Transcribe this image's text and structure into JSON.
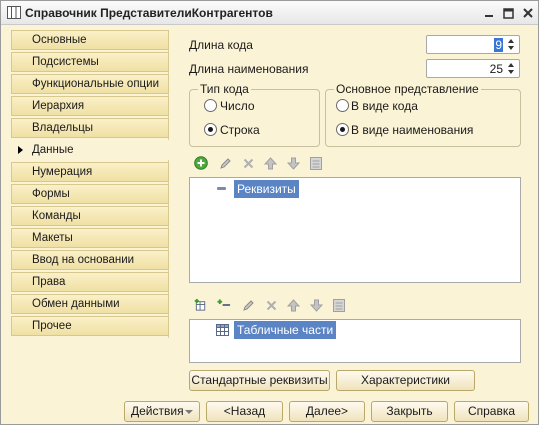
{
  "window": {
    "title": "Справочник ПредставителиКонтрагентов"
  },
  "sidebar": {
    "items": [
      {
        "label": "Основные"
      },
      {
        "label": "Подсистемы"
      },
      {
        "label": "Функциональные опции"
      },
      {
        "label": "Иерархия"
      },
      {
        "label": "Владельцы"
      },
      {
        "label": "Данные",
        "active": true
      },
      {
        "label": "Нумерация"
      },
      {
        "label": "Формы"
      },
      {
        "label": "Команды"
      },
      {
        "label": "Макеты"
      },
      {
        "label": "Ввод на основании"
      },
      {
        "label": "Права"
      },
      {
        "label": "Обмен данными"
      },
      {
        "label": "Прочее"
      }
    ]
  },
  "main": {
    "code_length_label": "Длина кода",
    "code_length_value": "9",
    "name_length_label": "Длина наименования",
    "name_length_value": "25",
    "code_type": {
      "title": "Тип кода",
      "options": [
        {
          "label": "Число",
          "selected": false
        },
        {
          "label": "Строка",
          "selected": true
        }
      ]
    },
    "main_presentation": {
      "title": "Основное представление",
      "options": [
        {
          "label": "В виде кода",
          "selected": false
        },
        {
          "label": "В виде наименования",
          "selected": true
        }
      ]
    },
    "attributes_tree": {
      "item": "Реквизиты"
    },
    "tabular_tree": {
      "item": "Табличные части"
    },
    "std_attrs_button": "Стандартные реквизиты",
    "characteristics_button": "Характеристики"
  },
  "footer": {
    "actions": "Действия",
    "back": "<Назад",
    "next": "Далее>",
    "close": "Закрыть",
    "help": "Справка"
  },
  "colors": {
    "background": "#fbf3d6",
    "selection": "#5b84c4"
  }
}
